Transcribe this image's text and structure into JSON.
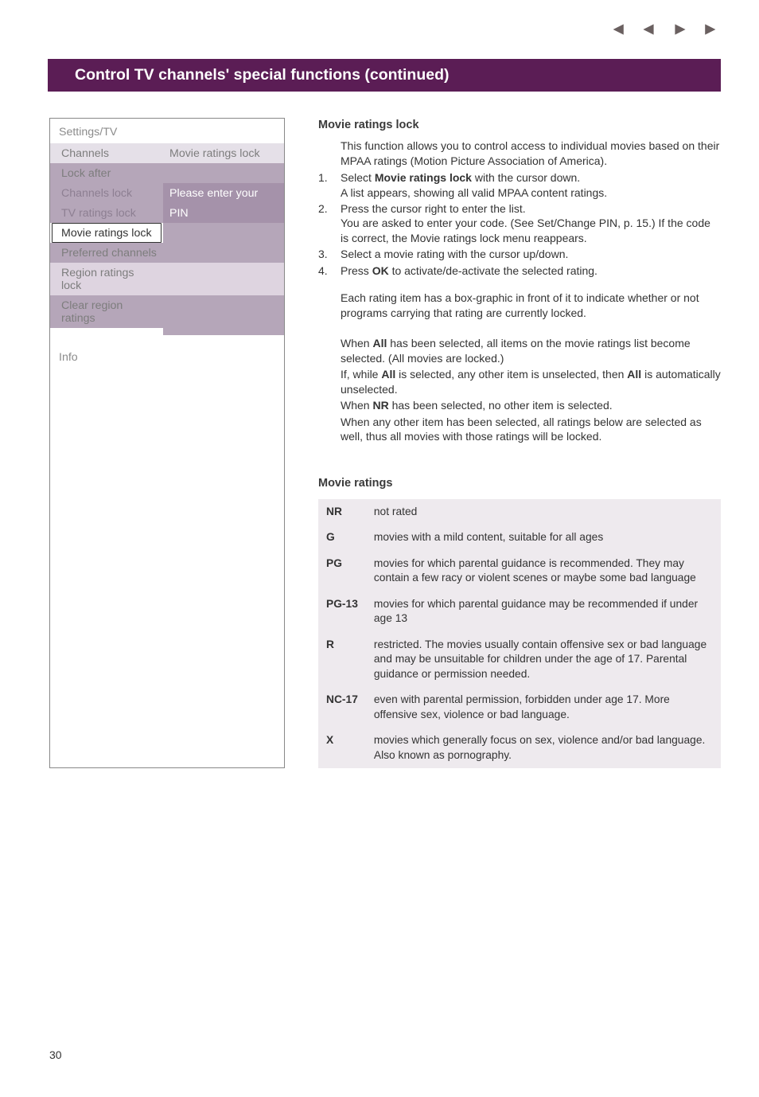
{
  "title_bar": "Control TV channels' special functions   (continued)",
  "settings_panel": {
    "header": "Settings/TV",
    "rows": [
      {
        "left": "Channels",
        "right": "Movie ratings lock",
        "cls": "row-light"
      },
      {
        "left": "Lock after",
        "right": "",
        "cls": "row-stripe-dark"
      },
      {
        "left": "Channels lock",
        "right": "Please enter your",
        "cls": "row-dark-active"
      },
      {
        "left": "TV ratings lock",
        "right": "PIN",
        "cls": "row-dark-active"
      },
      {
        "left": "Movie ratings lock",
        "right": "",
        "cls": "row-selected"
      },
      {
        "left": "Preferred channels",
        "right": "",
        "cls": "row-stripe-dark"
      },
      {
        "left": "Region ratings lock",
        "right": "",
        "cls": "row-stripe-light"
      },
      {
        "left": "Clear region ratings",
        "right": "",
        "cls": "row-stripe-dark"
      },
      {
        "left": "",
        "right": "",
        "cls": "row-empty"
      }
    ],
    "footer": "Info"
  },
  "section_title": "Movie ratings lock",
  "intro": "This function allows you to control access to individual movies based on their MPAA ratings (Motion Picture Association of America).",
  "steps": [
    {
      "pre": "Select ",
      "b1": "Movie ratings lock",
      "post": " with the cursor down.",
      "sub": "A list appears, showing all valid MPAA content ratings."
    },
    {
      "pre": "Press the cursor right to enter the list.",
      "sub": "You are asked to enter your code. (See Set/Change PIN, p. 15.) If the code is correct, the Movie ratings lock menu reappears."
    },
    {
      "pre": "Select a movie rating with the cursor up/down."
    },
    {
      "pre": "Press ",
      "b1": "OK",
      "post": " to activate/de-activate the selected rating."
    }
  ],
  "after_steps_1": "Each rating item has a box-graphic in front of it to indicate whether or not programs carrying that rating are currently locked.",
  "after_steps_2a": "When ",
  "after_steps_2b": "All",
  "after_steps_2c": " has been selected, all items on the movie ratings list become selected. (All movies are locked.)",
  "after_steps_3a": "If, while ",
  "after_steps_3b": "All",
  "after_steps_3c": " is selected, any other item is unselected, then ",
  "after_steps_3d": "All",
  "after_steps_3e": " is automatically unselected.",
  "after_steps_4a": "When ",
  "after_steps_4b": "NR",
  "after_steps_4c": " has been selected, no other item is selected.",
  "after_steps_5": "When any other item has been selected, all ratings below are selected as well, thus all movies with those ratings will be locked.",
  "ratings_title": "Movie ratings",
  "ratings": [
    {
      "code": "NR",
      "desc": "not rated"
    },
    {
      "code": "G",
      "desc": "movies with a mild content, suitable for all ages"
    },
    {
      "code": "PG",
      "desc": "movies for which parental guidance is recommended. They may contain a few racy or violent scenes or maybe some bad language"
    },
    {
      "code": "PG-13",
      "desc": "movies for which parental guidance may be recommended if under age 13"
    },
    {
      "code": "R",
      "desc": "restricted. The movies usually contain offensive sex or bad language and may be unsuitable for children under the age of 17. Parental guidance or permission needed."
    },
    {
      "code": "NC-17",
      "desc": "even with parental permission, forbidden under age 17. More offensive sex, violence or bad language."
    },
    {
      "code": "X",
      "desc": "movies which generally focus on sex, violence and/or bad language. Also known as pornography."
    }
  ],
  "page_num": "30"
}
